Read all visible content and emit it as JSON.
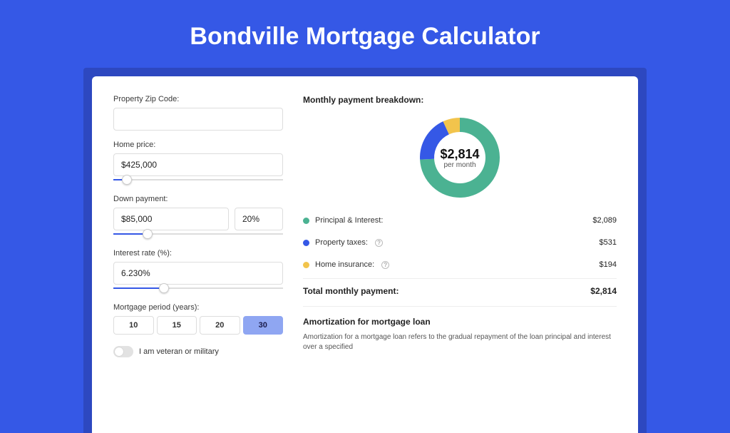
{
  "title": "Bondville Mortgage Calculator",
  "colors": {
    "accent": "#3558E6",
    "card_accent": "#2D48C0",
    "green": "#4BB292",
    "blue": "#3558E6",
    "yellow": "#F2C44C"
  },
  "left": {
    "zip_label": "Property Zip Code:",
    "zip_value": "",
    "home_price_label": "Home price:",
    "home_price_value": "$425,000",
    "home_price_slider_pct": 8,
    "down_label": "Down payment:",
    "down_value": "$85,000",
    "down_pct_value": "20%",
    "down_slider_pct": 20,
    "rate_label": "Interest rate (%):",
    "rate_value": "6.230%",
    "rate_slider_pct": 30,
    "period_label": "Mortgage period (years):",
    "periods": [
      "10",
      "15",
      "20",
      "30"
    ],
    "period_active": 3,
    "veteran_label": "I am veteran or military",
    "veteran_on": false
  },
  "right": {
    "breakdown_title": "Monthly payment breakdown:",
    "donut_value": "$2,814",
    "donut_sub": "per month",
    "rows": [
      {
        "key": "pi",
        "label": "Principal & Interest:",
        "amount": "$2,089",
        "help": false
      },
      {
        "key": "pt",
        "label": "Property taxes:",
        "amount": "$531",
        "help": true
      },
      {
        "key": "hi",
        "label": "Home insurance:",
        "amount": "$194",
        "help": true
      }
    ],
    "total_label": "Total monthly payment:",
    "total_amount": "$2,814",
    "amort_title": "Amortization for mortgage loan",
    "amort_text": "Amortization for a mortgage loan refers to the gradual repayment of the loan principal and interest over a specified"
  },
  "chart_data": {
    "type": "pie",
    "title": "Monthly payment breakdown",
    "series": [
      {
        "name": "Principal & Interest",
        "value": 2089,
        "color": "#4BB292"
      },
      {
        "name": "Property taxes",
        "value": 531,
        "color": "#3558E6"
      },
      {
        "name": "Home insurance",
        "value": 194,
        "color": "#F2C44C"
      }
    ],
    "total": 2814,
    "center_label": "$2,814",
    "center_sublabel": "per month"
  }
}
